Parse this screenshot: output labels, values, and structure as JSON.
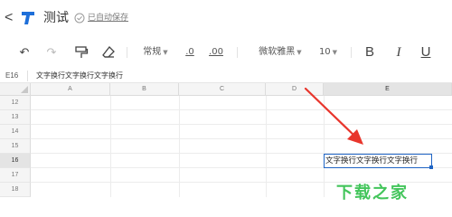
{
  "header": {
    "back_label": "<",
    "app_icon": "app-logo-icon",
    "title": "测试",
    "saved_text": "已自动保存",
    "saved_icon": "check-circle-icon"
  },
  "toolbar": {
    "undo": "↶",
    "redo": "↷",
    "format_painter": "format-painter-icon",
    "clear_format": "eraser-icon",
    "number_format": "常规",
    "decrease_decimal": ".0",
    "increase_decimal": ".00",
    "font_family": "微软雅黑",
    "font_size": "10",
    "bold": "B",
    "italic": "I",
    "underline": "U"
  },
  "formula_bar": {
    "cell_ref": "E16",
    "content": "文字换行文字换行文字换行"
  },
  "grid": {
    "columns": [
      "A",
      "B",
      "C",
      "D",
      "E"
    ],
    "selected_column": "E",
    "rows": [
      "12",
      "13",
      "14",
      "15",
      "16",
      "17",
      "18"
    ],
    "selected_row": "16",
    "active_cell_value": "文字换行文字换行文字换行"
  },
  "annotation": {
    "arrow_color": "#e8352c"
  },
  "watermark_text": "下载之家"
}
